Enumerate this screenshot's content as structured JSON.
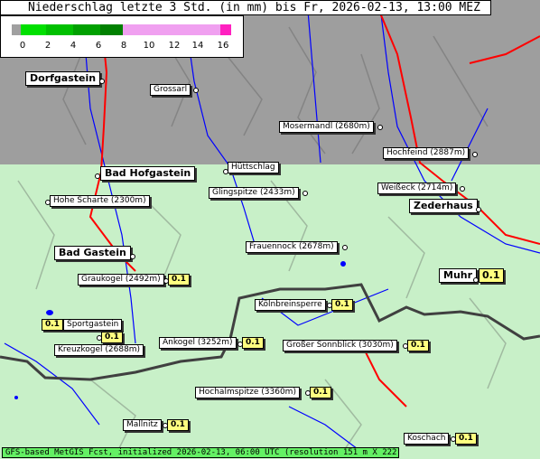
{
  "title": "Niederschlag letzte 3 Std. (in mm) bis Fr, 2026-02-13, 13:00 MEZ",
  "legend": {
    "ticks": [
      "0",
      "2",
      "4",
      "6",
      "8",
      "10",
      "12",
      "14",
      "16"
    ],
    "colors": {
      "none": "#a0a0a0",
      "low": "#00e000",
      "mid": "#008000",
      "high": "#f0a0f0",
      "max": "#ff20c0"
    }
  },
  "map_colors": {
    "gray_zone": "#9e9e9e",
    "green_zone": "#c8f0c8",
    "rivers": "#0000ff",
    "roads": "#ff0000",
    "border": "#404040"
  },
  "towns": [
    {
      "name": "Dorfgastein"
    },
    {
      "name": "Bad Hofgastein"
    },
    {
      "name": "Zederhaus"
    },
    {
      "name": "Bad Gastein"
    },
    {
      "name": "Muhr",
      "value": "0.1"
    }
  ],
  "places": [
    {
      "name": "Grossarl"
    },
    {
      "name": "Mosermandl (2680m)"
    },
    {
      "name": "Hochfeind (2887m)"
    },
    {
      "name": "Hüttschlag"
    },
    {
      "name": "Weißeck (2714m)"
    },
    {
      "name": "Glingspitze (2433m)"
    },
    {
      "name": "Hohe Scharte (2300m)"
    },
    {
      "name": "Frauennock (2678m)"
    },
    {
      "name": "Graukogel (2492m)",
      "value": "0.1"
    },
    {
      "name": "Kölnbreinsperre",
      "value": "0.1"
    },
    {
      "name": "Sportgastein",
      "value": "0.1",
      "value_left": true
    },
    {
      "name": "Kreuzkogel (2688m)",
      "value": "0.1"
    },
    {
      "name": "Ankogel (3252m)",
      "value": "0.1"
    },
    {
      "name": "Großer Sonnblick (3030m)",
      "value": "0.1"
    },
    {
      "name": "Hochalmspitze (3360m)",
      "value": "0.1"
    },
    {
      "name": "Mallnitz",
      "value": "0.1"
    },
    {
      "name": "Koschach",
      "value": "0.1"
    }
  ],
  "footer": "GFS-based MetGIS Fcst, initialized 2026-02-13, 06:00 UTC  (resolution 151 m X 222 m)"
}
